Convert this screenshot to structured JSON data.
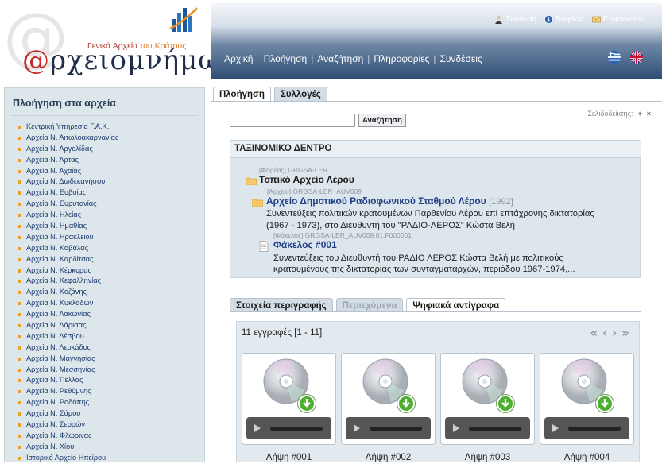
{
  "logo": {
    "subtitle_part1": "Γενικά Αρχεία",
    "subtitle_part2": " του Κράτους",
    "brand_at": "@",
    "brand_rest": "ρχειομνήμων"
  },
  "top_links": [
    {
      "label": "Σύνδεση",
      "icon": "user-icon"
    },
    {
      "label": "Βοήθεια",
      "icon": "info-icon"
    },
    {
      "label": "Επικοινωνία",
      "icon": "mail-icon"
    }
  ],
  "nav": [
    "Αρχική",
    "Πλοήγηση",
    "Αναζήτηση",
    "Πληροφορίες",
    "Συνδέσεις"
  ],
  "nav_separator": "|",
  "flags": [
    "greek-flag",
    "uk-flag"
  ],
  "sidebar": {
    "title": "Πλοήγηση στα αρχεία",
    "items": [
      "Κεντρική Υπηρεσία Γ.Α.Κ.",
      "Αρχεία Ν. Αιτωλοακαρνανίας",
      "Αρχεία Ν. Αργολίδας",
      "Αρχεία Ν. Άρτας",
      "Αρχεία Ν. Αχαΐας",
      "Αρχεία Ν. Δωδεκανήσου",
      "Αρχεία Ν. Ευβοίας",
      "Αρχεία Ν. Ευρυτανίας",
      "Αρχεία Ν. Ηλείας",
      "Αρχεία Ν. Ημαθίας",
      "Αρχεία Ν. Ηρακλείου",
      "Αρχεία Ν. Καβάλας",
      "Αρχεία Ν. Καρδίτσας",
      "Αρχεία Ν. Κέρκυρας",
      "Αρχεία Ν. Κεφαλληνίας",
      "Αρχεία Ν. Κοζάνης",
      "Αρχεία Ν. Κυκλάδων",
      "Αρχεία Ν. Λακωνίας",
      "Αρχεία Ν. Λάρισας",
      "Αρχεία Ν. Λέσβου",
      "Αρχεία Ν. Λευκάδος",
      "Αρχεία Ν. Μαγνησίας",
      "Αρχεία Ν. Μεσσηνίας",
      "Αρχεία Ν. Πέλλας",
      "Αρχεία Ν. Ρεθύμνης",
      "Αρχεία Ν. Ροδόπης",
      "Αρχεία Ν. Σάμου",
      "Αρχεία Ν. Σερρών",
      "Αρχεία Ν. Φλώρινας",
      "Αρχεία Ν. Χίου",
      "Ιστορικό Αρχείο Ηπείρου"
    ]
  },
  "main_tabs": [
    {
      "label": "Πλοήγηση",
      "state": "active"
    },
    {
      "label": "Συλλογές",
      "state": "inactive"
    }
  ],
  "bookmark": {
    "label": "Σελιδοδείκτης:",
    "add": "+",
    "remove": "×"
  },
  "search": {
    "value": "",
    "button": "Αναζήτηση"
  },
  "tree": {
    "title": "ΤΑΞΙΝΟΜΙΚΟ ΔΕΝΤΡΟ",
    "nodes": [
      {
        "meta": "[Φορέας] GRGSA-LER",
        "label": "Τοπικό Αρχείο Λέρου"
      },
      {
        "meta": "[Αρχείο] GRGSA-LER_AUV009",
        "label": "Αρχείο Δημοτικού Ραδιοφωνικού Σταθμού Λέρου",
        "year": "[1992]",
        "desc1": "Συνεντεύξεις πολιτικών κρατουμένων Παρθενίου Λέρου επί επτάχρονης δικτατορίας",
        "desc2": "(1967 - 1973), στο Διευθυντή του \"ΡΑΔΙΟ-ΛΕΡΟΣ\" Κώστα Βελή"
      },
      {
        "meta": "[Φάκελος] GRGSA-LER_AUV009.01.F000001",
        "label": "Φάκελος #001",
        "desc1": "Συνεντεύξεις του Διευθυντή του ΡΑΔΙΟ ΛΕΡΟΣ Κώστα Βελή με πολιτικούς",
        "desc2": "κρατουμένους της δικτατορίας των συνταγματαρχών, περιόδου 1967-1974,..."
      }
    ]
  },
  "detail_tabs": [
    {
      "label": "Στοιχεία περιγραφής",
      "state": "inactive"
    },
    {
      "label": "Περιεχόμενα",
      "state": "disabled"
    },
    {
      "label": "Ψηφιακά αντίγραφα",
      "state": "active"
    }
  ],
  "records": {
    "count_text": "11 εγγραφές [1 - 11]",
    "pager": [
      "«",
      "‹",
      "›",
      "»"
    ],
    "items": [
      "Λήψη #001",
      "Λήψη #002",
      "Λήψη #003",
      "Λήψη #004"
    ]
  },
  "colors": {
    "header_dark": "#2e4d74",
    "sidebar_bg": "#dde7eb",
    "link_blue": "#1d3a6e",
    "bullet": "#f0a020",
    "download_green": "#4caf2f"
  }
}
